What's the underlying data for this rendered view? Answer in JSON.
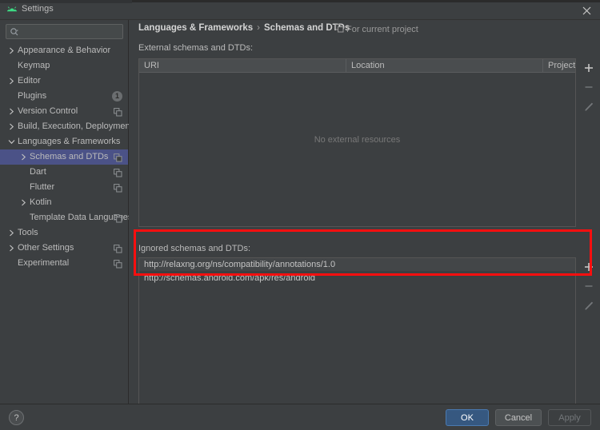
{
  "window": {
    "title": "Settings",
    "app_icon": "android-studio-icon",
    "close_icon": "close-icon"
  },
  "sidebar": {
    "search": {
      "value": "",
      "placeholder": "",
      "icon": "search-icon"
    },
    "items": [
      {
        "label": "Appearance & Behavior",
        "indent": 0,
        "arrow": "right",
        "copy": false,
        "badge": null,
        "selected": false
      },
      {
        "label": "Keymap",
        "indent": 0,
        "arrow": "none",
        "copy": false,
        "badge": null,
        "selected": false
      },
      {
        "label": "Editor",
        "indent": 0,
        "arrow": "right",
        "copy": false,
        "badge": null,
        "selected": false
      },
      {
        "label": "Plugins",
        "indent": 0,
        "arrow": "none",
        "copy": false,
        "badge": "1",
        "selected": false
      },
      {
        "label": "Version Control",
        "indent": 0,
        "arrow": "right",
        "copy": true,
        "badge": null,
        "selected": false
      },
      {
        "label": "Build, Execution, Deployment",
        "indent": 0,
        "arrow": "right",
        "copy": false,
        "badge": null,
        "selected": false
      },
      {
        "label": "Languages & Frameworks",
        "indent": 0,
        "arrow": "down",
        "copy": false,
        "badge": null,
        "selected": false
      },
      {
        "label": "Schemas and DTDs",
        "indent": 1,
        "arrow": "right",
        "copy": true,
        "badge": null,
        "selected": true
      },
      {
        "label": "Dart",
        "indent": 1,
        "arrow": "none",
        "copy": true,
        "badge": null,
        "selected": false
      },
      {
        "label": "Flutter",
        "indent": 1,
        "arrow": "none",
        "copy": true,
        "badge": null,
        "selected": false
      },
      {
        "label": "Kotlin",
        "indent": 1,
        "arrow": "right",
        "copy": false,
        "badge": null,
        "selected": false
      },
      {
        "label": "Template Data Languages",
        "indent": 1,
        "arrow": "none",
        "copy": true,
        "badge": null,
        "selected": false
      },
      {
        "label": "Tools",
        "indent": 0,
        "arrow": "right",
        "copy": false,
        "badge": null,
        "selected": false
      },
      {
        "label": "Other Settings",
        "indent": 0,
        "arrow": "right",
        "copy": true,
        "badge": null,
        "selected": false
      },
      {
        "label": "Experimental",
        "indent": 0,
        "arrow": "none",
        "copy": true,
        "badge": null,
        "selected": false
      }
    ]
  },
  "main": {
    "breadcrumb": {
      "parent": "Languages & Frameworks",
      "separator": "›",
      "current": "Schemas and DTDs"
    },
    "for_current_project": {
      "label": "For current project",
      "icon": "project-scope-icon"
    },
    "external": {
      "label": "External schemas and DTDs:",
      "columns": [
        "URI",
        "Location",
        "Project"
      ],
      "rows": [],
      "empty_text": "No external resources",
      "toolbar": [
        {
          "name": "add-external-button",
          "icon": "plus-icon",
          "enabled": true
        },
        {
          "name": "remove-external-button",
          "icon": "minus-icon",
          "enabled": false
        },
        {
          "name": "edit-external-button",
          "icon": "pencil-icon",
          "enabled": false
        }
      ]
    },
    "ignored": {
      "label": "Ignored schemas and DTDs:",
      "rows": [
        "http://relaxng.org/ns/compatibility/annotations/1.0",
        "http://schemas.android.com/apk/res/android"
      ],
      "toolbar": [
        {
          "name": "add-ignored-button",
          "icon": "plus-icon",
          "enabled": true
        },
        {
          "name": "remove-ignored-button",
          "icon": "minus-icon",
          "enabled": false
        },
        {
          "name": "edit-ignored-button",
          "icon": "pencil-icon",
          "enabled": false
        }
      ]
    },
    "annotation": {
      "shape": "rectangle",
      "color": "#fa0f0f"
    }
  },
  "footer": {
    "help": "?",
    "ok": "OK",
    "cancel": "Cancel",
    "apply": "Apply"
  },
  "colors": {
    "window_bg": "#3c3f41",
    "panel_border": "#2b2b2b",
    "selection": "#4b5287",
    "primary_button": "#365880",
    "annotation": "#fa0f0f",
    "text": "#bbbbbb"
  }
}
